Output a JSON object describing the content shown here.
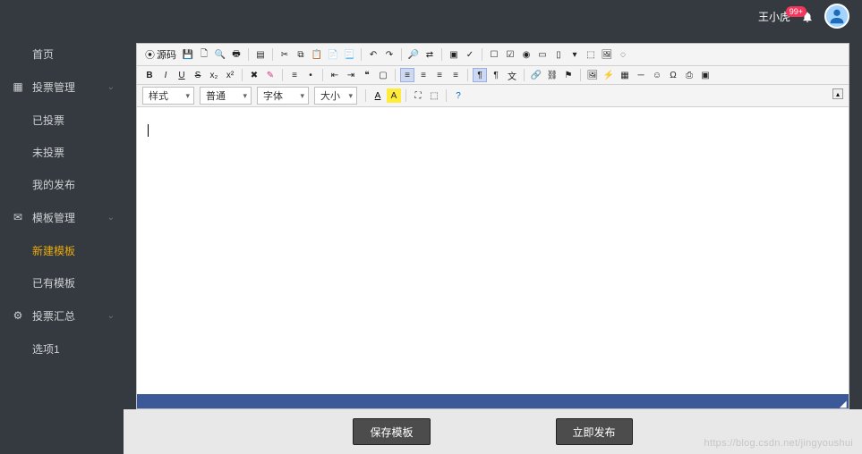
{
  "header": {
    "user_name": "王小虎",
    "badge": "99+"
  },
  "sidebar": {
    "groups": [
      {
        "icon": "mail",
        "label": "首页",
        "items": [
          {
            "label": "首页"
          }
        ]
      },
      {
        "icon": "grid",
        "label": "投票管理",
        "items": [
          {
            "label": "已投票"
          },
          {
            "label": "未投票"
          },
          {
            "label": "我的发布"
          }
        ]
      },
      {
        "icon": "mail",
        "label": "模板管理",
        "items": [
          {
            "label": "新建模板",
            "active": true
          },
          {
            "label": "已有模板"
          }
        ]
      },
      {
        "icon": "gear",
        "label": "投票汇总",
        "items": [
          {
            "label": "选项1"
          }
        ]
      }
    ]
  },
  "editor": {
    "source_label": "源码",
    "dropdowns": {
      "style": "样式",
      "para": "普通",
      "font": "字体",
      "size": "大小"
    },
    "collapse": "▴"
  },
  "buttons": {
    "save": "保存模板",
    "publish": "立即发布"
  },
  "watermark": "https://blog.csdn.net/jingyoushui"
}
